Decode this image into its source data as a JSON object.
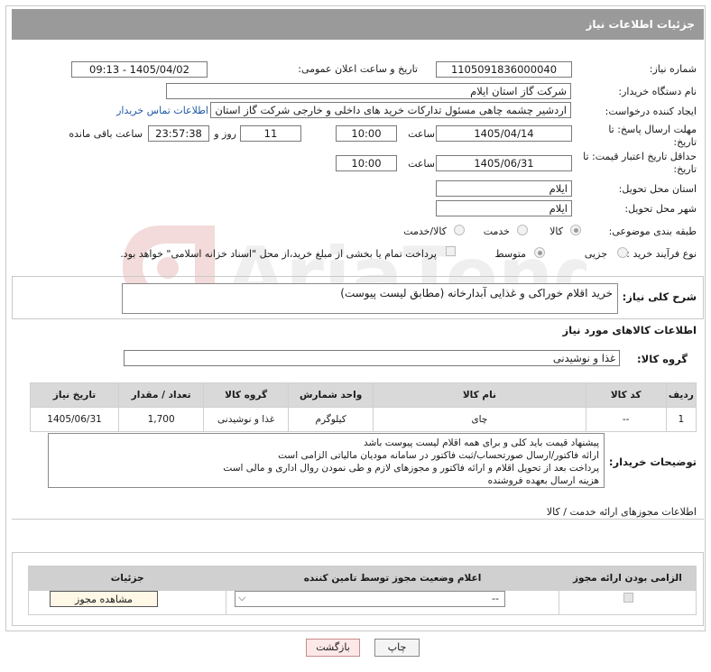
{
  "header": {
    "title": "جزئیات اطلاعات نیاز"
  },
  "fields": {
    "need_number_label": "شماره نیاز:",
    "need_number": "1105091836000040",
    "announce_label": "تاریخ و ساعت اعلان عمومی:",
    "announce_value": "1405/04/02 - 09:13",
    "buyer_org_label": "نام دستگاه خریدار:",
    "buyer_org": "شرکت گاز استان ایلام",
    "creator_label": "ایجاد کننده درخواست:",
    "creator": "اردشیر چشمه چاهی مسئول تدارکات خرید های داخلی و خارجی  شرکت گاز استان ایلام",
    "contact_link": "اطلاعات تماس خریدار",
    "deadline_label": "مهلت ارسال پاسخ: تا تاریخ:",
    "deadline_date": "1405/04/14",
    "hour_label": "ساعت",
    "deadline_time": "10:00",
    "days_value": "11",
    "days_label": "روز و",
    "remaining_value": "23:57:38",
    "remaining_label": "ساعت باقی مانده",
    "validity_label": "حداقل تاریخ اعتبار قیمت: تا تاریخ:",
    "validity_date": "1405/06/31",
    "validity_time": "10:00",
    "province_label": "استان محل تحویل:",
    "province": "ایلام",
    "city_label": "شهر محل تحویل:",
    "city": "ایلام",
    "category_label": "طبقه بندی موضوعی:",
    "category_options": [
      "کالا",
      "خدمت",
      "کالا/خدمت"
    ],
    "purchase_label": "نوع فرآیند خرید :",
    "purchase_options": [
      "جزیی",
      "متوسط"
    ],
    "payment_note": "پرداخت تمام یا بخشی از مبلغ خرید،از محل \"اسناد خزانه اسلامی\" خواهد بود."
  },
  "description": {
    "label": "شرح کلی نیاز:",
    "text": "خرید اقلام خوراکی و غذایی آبدارخانه (مطابق لیست پیوست)"
  },
  "goods": {
    "section_title": "اطلاعات کالاهای مورد نیاز",
    "group_label": "گروه کالا:",
    "group_value": "غذا و نوشیدنی",
    "columns": [
      "ردیف",
      "کد کالا",
      "نام کالا",
      "واحد شمارش",
      "گروه کالا",
      "تعداد / مقدار",
      "تاریخ نیاز"
    ],
    "rows": [
      [
        "1",
        "--",
        "چای",
        "کیلوگرم",
        "غذا و نوشیدنی",
        "1,700",
        "1405/06/31"
      ]
    ]
  },
  "buyer_notes": {
    "label": "توضیحات خریدار:",
    "lines": [
      "پیشنهاد قیمت باید کلی و برای همه اقلام لیست پیوست باشد",
      "ارائه فاکتور/ارسال صورتحساب/ثبت فاکتور در سامانه مودیان مالیاتی الزامی است",
      "پرداخت بعد از تحویل اقلام و ارائه فاکتور و مجوزهای لازم و طی نمودن روال اداری و مالی است",
      "هزینه ارسال بعهده فروشنده"
    ]
  },
  "permits": {
    "title": "اطلاعات مجوزهای ارائه خدمت / کالا",
    "columns": [
      "الزامی بودن ارائه مجوز",
      "اعلام وضعیت مجوز توسط تامین کننده",
      "جزئیات"
    ],
    "select_value": "--",
    "view_button": "مشاهده مجوز"
  },
  "buttons": {
    "print": "چاپ",
    "back": "بازگشت"
  },
  "watermark_text": "AriaTender.net"
}
